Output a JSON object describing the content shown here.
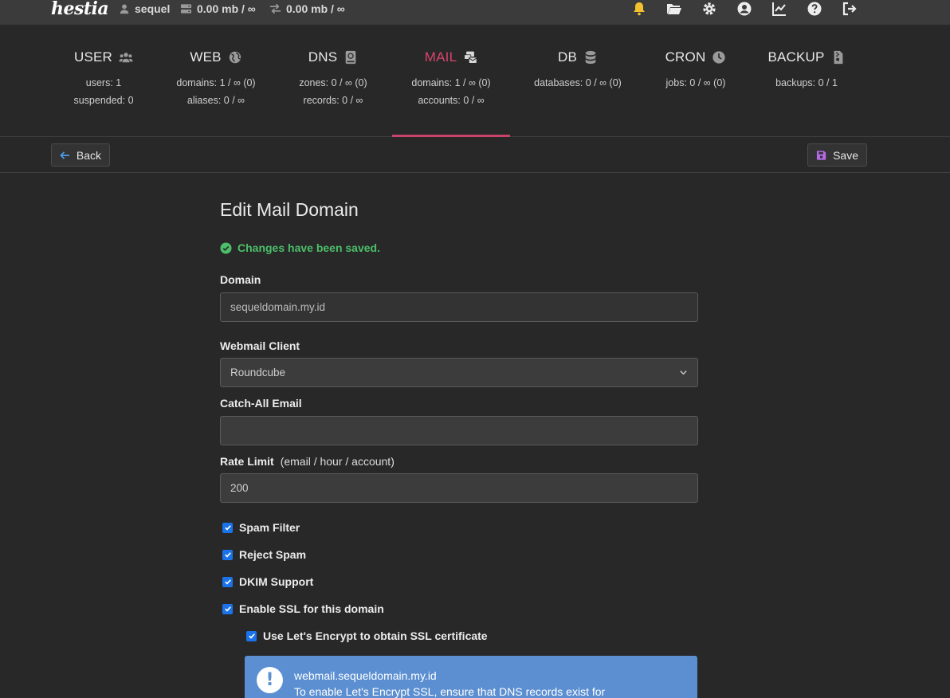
{
  "topbar": {
    "logo": "hestia",
    "user": "sequel",
    "disk": "0.00 mb / ∞",
    "bandwidth": "0.00 mb / ∞"
  },
  "stats": [
    {
      "label": "USER",
      "line1": "users: 1",
      "line2": "suspended: 0",
      "icon": "users-icon"
    },
    {
      "label": "WEB",
      "line1": "domains: 1 / ∞ (0)",
      "line2": "aliases: 0 / ∞",
      "icon": "globe-icon"
    },
    {
      "label": "DNS",
      "line1": "zones: 0 / ∞ (0)",
      "line2": "records: 0 / ∞",
      "icon": "book-icon"
    },
    {
      "label": "MAIL",
      "line1": "domains: 1 / ∞ (0)",
      "line2": "accounts: 0 / ∞",
      "icon": "mail-bulk-icon",
      "active": true
    },
    {
      "label": "DB",
      "line1": "databases: 0 / ∞ (0)",
      "line2": "",
      "icon": "database-icon"
    },
    {
      "label": "CRON",
      "line1": "jobs: 0 / ∞ (0)",
      "line2": "",
      "icon": "clock-icon"
    },
    {
      "label": "BACKUP",
      "line1": "backups: 0 / 1",
      "line2": "",
      "icon": "file-archive-icon"
    }
  ],
  "toolbar": {
    "back_label": "Back",
    "save_label": "Save"
  },
  "form": {
    "title": "Edit Mail Domain",
    "success_message": "Changes have been saved.",
    "domain_label": "Domain",
    "domain_value": "sequeldomain.my.id",
    "webmail_label": "Webmail Client",
    "webmail_value": "Roundcube",
    "catchall_label": "Catch-All Email",
    "catchall_value": "",
    "rate_label": "Rate Limit",
    "rate_hint": "(email / hour / account)",
    "rate_value": "200",
    "spam_filter": "Spam Filter",
    "reject_spam": "Reject Spam",
    "dkim": "DKIM Support",
    "ssl": "Enable SSL for this domain",
    "letsencrypt": "Use Let's Encrypt to obtain SSL certificate",
    "info_line1": "webmail.sequeldomain.my.id",
    "info_line2": "To enable Let's Encrypt SSL, ensure that DNS records exist for"
  },
  "colors": {
    "accent": "#c8426a",
    "success": "#4cbf6a",
    "info": "#5b8fd1",
    "checkbox": "#1a73e8",
    "bell": "#f2c12e"
  }
}
